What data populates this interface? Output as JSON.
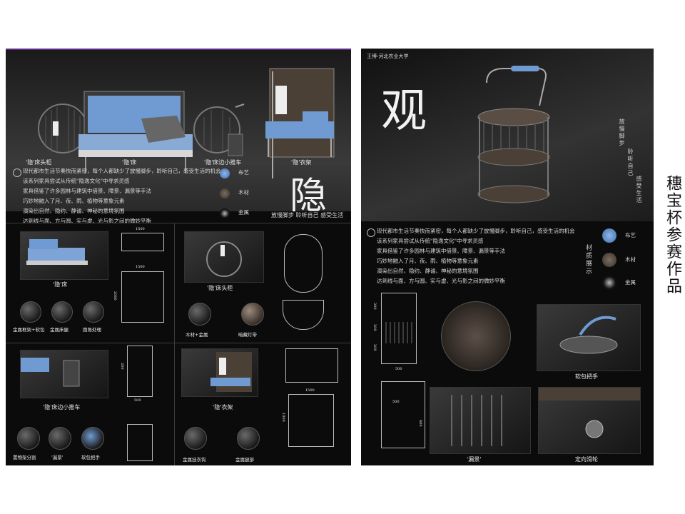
{
  "left": {
    "hero_captions": [
      "'隐'床头柜",
      "'隐'床",
      "'隐'床边小推车",
      "'隐'衣架"
    ],
    "intro_lines": [
      "现代都市生活节奏快而紧密，每个人都缺少了放慢脚步，聆听自己，感受生活的机会",
      "该系列家具尝试从传统\"隐逸文化\"中寻求灵感",
      "家具借鉴了许多园林与建筑中借景、障景、漏景等手法",
      "巧妙地融入了月、夜、雨、植物等意象元素",
      "演染出自然、隐约、静谧、神秘的意境氛围",
      "达到线与面、方与圆、实与虚、光与影之间的微妙平衡"
    ],
    "materials": [
      "布艺",
      "木材",
      "金属"
    ],
    "big_char": "隐",
    "slogan": "放慢脚步 聆听自己 感受生活",
    "sections": {
      "bed": {
        "title": "'隐'床",
        "details": [
          "金属框架+软包",
          "金属床腿",
          "圆角处理"
        ],
        "dims": [
          "1500",
          "1500",
          "2000"
        ]
      },
      "nightstand": {
        "title": "'隐'床头柜",
        "details": [
          "木材+金属",
          "暗藏灯带"
        ]
      },
      "cart": {
        "title": "'隐'床边小推车",
        "details": [
          "置物架分割",
          "'漏景'",
          "软包把手"
        ],
        "dims": [
          "500",
          "200"
        ]
      },
      "rack": {
        "title": "'隐'衣架",
        "details": [
          "金属挂衣钩",
          "金属腿部"
        ],
        "dims": [
          "1500",
          "1000"
        ]
      }
    }
  },
  "right": {
    "header": "王博-河北农业大学",
    "big_char": "观",
    "vertical_poem": [
      "放慢脚步",
      "聆听自己",
      "感受生活"
    ],
    "intro_lines": [
      "现代都市生活节奏快而紧密，每个人都缺少了放慢脚步，聆听自己，感受生活的机会",
      "该系列家具尝试从传统\"隐逸文化\"中寻求灵感",
      "家具借鉴了许多园林与建筑中借景、障景、漏景等手法",
      "巧妙地融入了月、夜、雨、植物等意象元素",
      "演染出自然、隐约、静谧、神秘的意境氛围",
      "达到线与面、方与圆、实与虚、光与影之间的微妙平衡"
    ],
    "materials_title": "材质展示",
    "materials": [
      "布艺",
      "木材",
      "金属"
    ],
    "dims": [
      "200",
      "200",
      "200",
      "500",
      "500",
      "400"
    ],
    "detail_labels": [
      "软包把手",
      "'漏景'",
      "定向滑轮"
    ]
  },
  "side_title": "穗宝杯参赛作品",
  "colors": {
    "board": "#0b0b0b",
    "fabric": "#5b8fd0",
    "wood": "#5a4e44",
    "metal": "#3a3a3a",
    "accent": "#5b2a86"
  }
}
